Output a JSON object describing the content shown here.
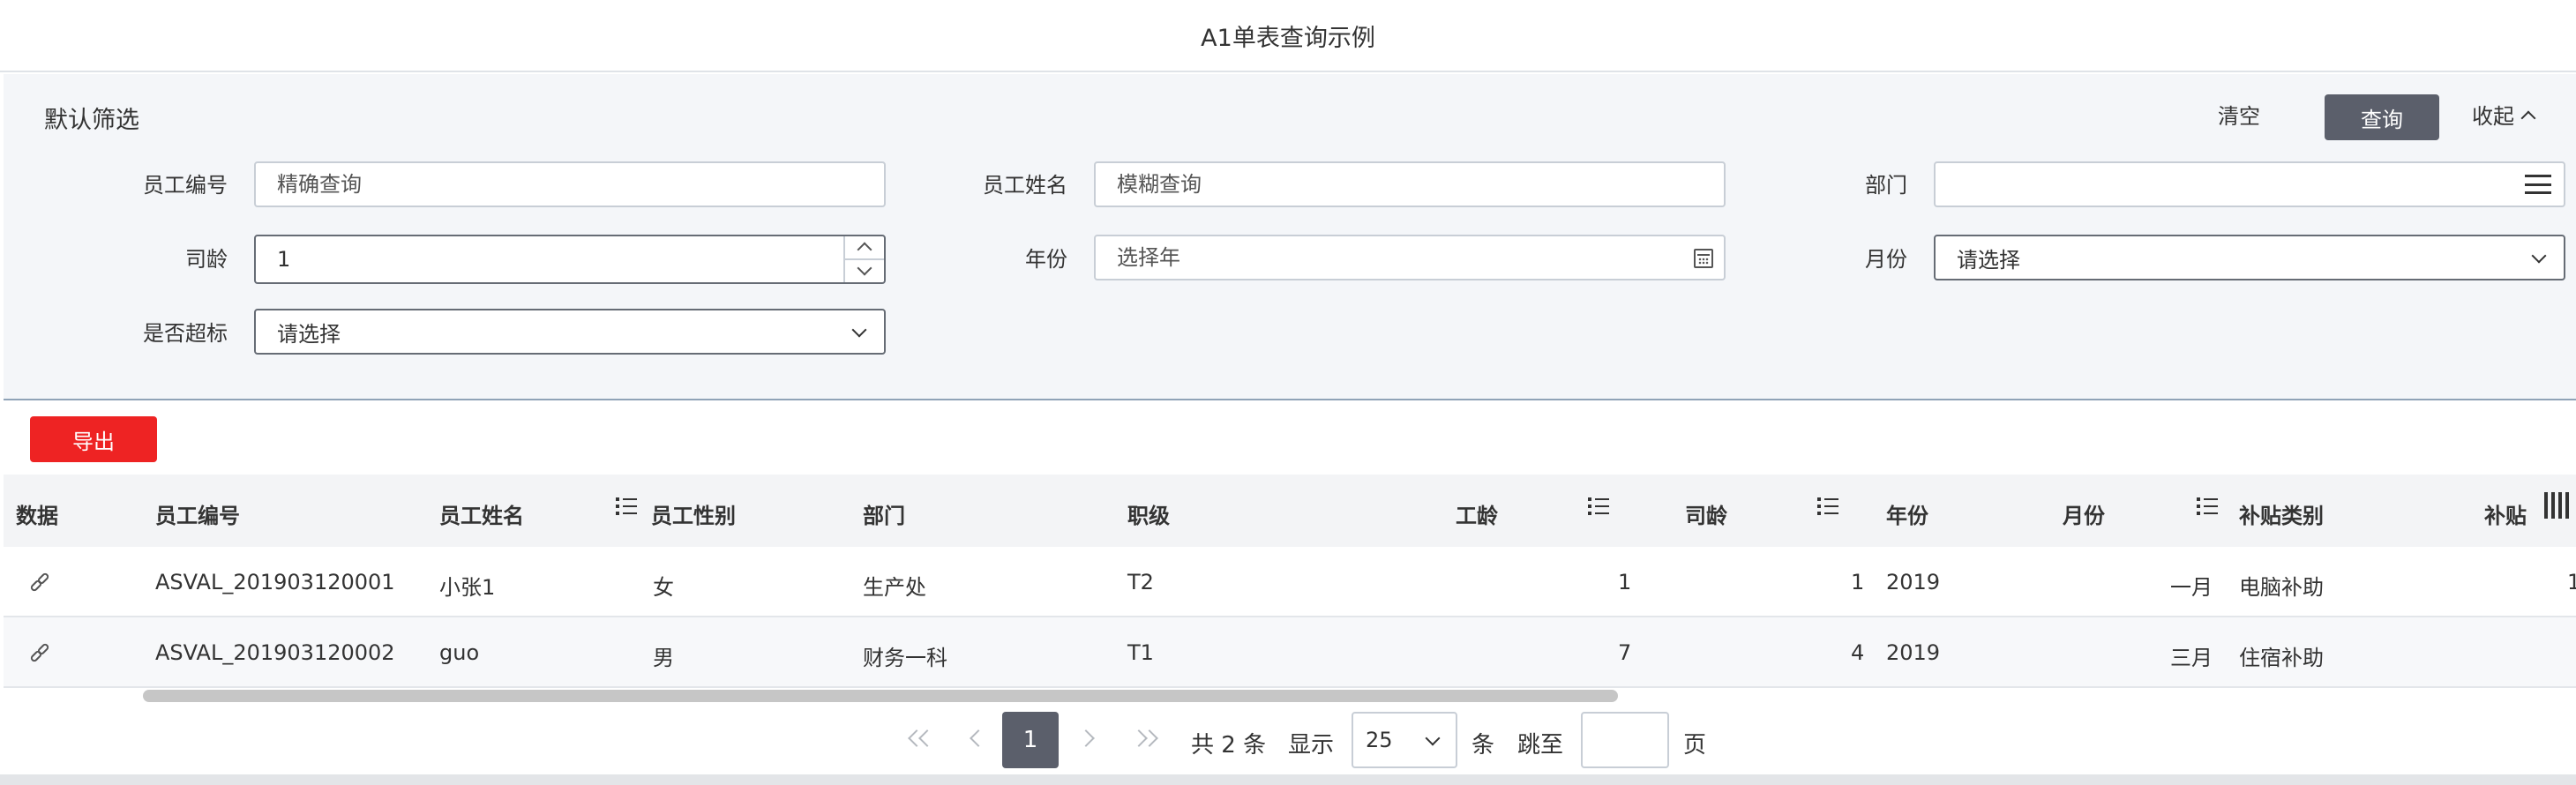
{
  "page": {
    "title": "A1单表查询示例"
  },
  "filter": {
    "title": "默认筛选",
    "clear_label": "清空",
    "query_label": "查询",
    "collapse_label": "收起",
    "fields": {
      "emp_no_label": "员工编号",
      "emp_no_placeholder": "精确查询",
      "emp_name_label": "员工姓名",
      "emp_name_placeholder": "模糊查询",
      "dept_label": "部门",
      "seniority_label": "司龄",
      "seniority_value": "1",
      "year_label": "年份",
      "year_placeholder": "选择年",
      "month_label": "月份",
      "month_value": "请选择",
      "exceed_label": "是否超标",
      "exceed_value": "请选择"
    }
  },
  "toolbar": {
    "export_label": "导出"
  },
  "table": {
    "headers": {
      "data": "数据",
      "emp_no": "员工编号",
      "emp_name": "员工姓名",
      "gender": "员工性别",
      "dept": "部门",
      "rank": "职级",
      "work_years": "工龄",
      "seniority": "司龄",
      "year": "年份",
      "month": "月份",
      "subsidy_type": "补贴类别",
      "subsidy": "补贴"
    },
    "rows": [
      {
        "emp_no": "ASVAL_201903120001",
        "emp_name": "小张1",
        "gender": "女",
        "dept": "生产处",
        "rank": "T2",
        "work_years": "1",
        "seniority": "1",
        "year": "2019",
        "month": "一月",
        "subsidy_type": "电脑补助",
        "subsidy": "1"
      },
      {
        "emp_no": "ASVAL_201903120002",
        "emp_name": "guo",
        "gender": "男",
        "dept": "财务一科",
        "rank": "T1",
        "work_years": "7",
        "seniority": "4",
        "year": "2019",
        "month": "三月",
        "subsidy_type": "住宿补助",
        "subsidy": ""
      }
    ]
  },
  "pagination": {
    "current_page": "1",
    "total_text": "共 2 条",
    "show_label": "显示",
    "page_size": "25",
    "unit_label": "条",
    "jump_label": "跳至",
    "page_label": "页"
  }
}
